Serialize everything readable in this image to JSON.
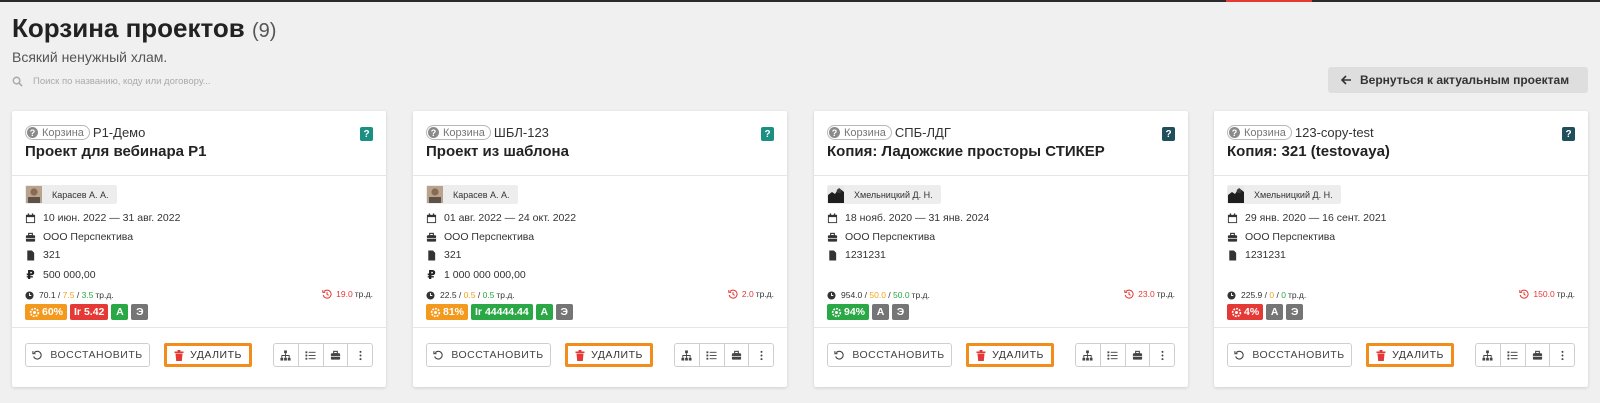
{
  "page": {
    "title": "Корзина проектов",
    "count": "(9)",
    "subtitle": "Всякий ненужный хлам.",
    "search_placeholder": "Поиск по названию, коду или договору...",
    "back_label": "Вернуться к актуальным проектам"
  },
  "colors": {
    "accent_orange": "#f28c1c",
    "red": "#e53935",
    "green": "#2aa845",
    "teal": "#1a8f82"
  },
  "labels": {
    "trash_badge": "Корзина",
    "trd": "тр.д.",
    "restore": "ВОССТАНОВИТЬ",
    "delete": "УДАЛИТЬ",
    "badge_a": "А",
    "badge_e": "Э"
  },
  "icons": [
    "search-icon",
    "arrow-left-icon",
    "calendar-icon",
    "briefcase-icon",
    "file-icon",
    "clock-icon",
    "history-icon",
    "gear-icon",
    "restore-icon",
    "trash-icon",
    "hierarchy-icon",
    "list-icon",
    "case-icon",
    "more-vertical-icon"
  ],
  "cards": [
    {
      "code": "Р1-Демо",
      "name": "Проект для вебинара Р1",
      "manager": "Карасев А. А.",
      "dates": "10 июн. 2022 — 31 авг. 2022",
      "company": "ООО Перспектива",
      "contract": "321",
      "budget": "500 000,00",
      "m1": "70.1",
      "m2": "7.5",
      "m3": "3.5",
      "rv": "19.0",
      "progress": "60%",
      "ir": "5.42"
    },
    {
      "code": "ШБЛ-123",
      "name": "Проект из шаблона",
      "manager": "Карасев А. А.",
      "dates": "01 авг. 2022 — 24 окт. 2022",
      "company": "ООО Перспектива",
      "contract": "321",
      "budget": "1 000 000 000,00",
      "m1": "22.5",
      "m2": "0.5",
      "m3": "0.5",
      "rv": "2.0",
      "progress": "81%",
      "ir": "44444.44"
    },
    {
      "code": "СПБ-ЛДГ",
      "name": "Копия: Ладожские просторы СТИКЕР",
      "manager": "Хмельницкий Д. Н.",
      "dates": "18 нояб. 2020 — 31 янв. 2024",
      "company": "ООО Перспектива",
      "contract": "1231231",
      "m1": "954.0",
      "m2": "50.0",
      "m3": "50.0",
      "rv": "23.0",
      "progress": "94%"
    },
    {
      "code": "123-copy-test",
      "name": "Копия: 321 (testovaya)",
      "manager": "Хмельницкий Д. Н.",
      "dates": "29 янв. 2020 — 16 сент. 2021",
      "company": "ООО Перспектива",
      "contract": "1231231",
      "m1": "225.9",
      "m2": "0",
      "m3": "0",
      "rv": "150.0",
      "progress": "4%"
    }
  ]
}
